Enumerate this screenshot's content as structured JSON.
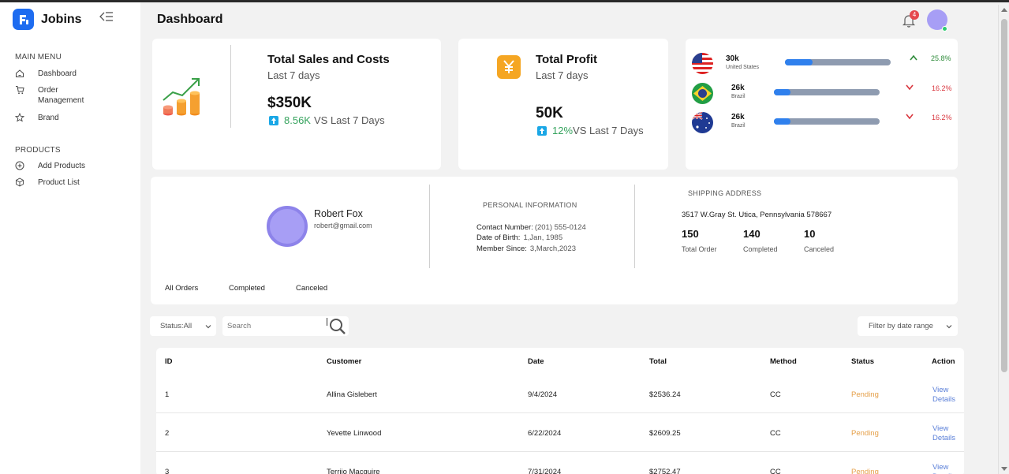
{
  "app": {
    "name": "Jobins"
  },
  "sidebar": {
    "main_menu_label": "MAIN MENU",
    "main_items": [
      {
        "label": "Dashboard",
        "icon": "home-icon"
      },
      {
        "label": "Order Management",
        "icon": "cart-icon"
      },
      {
        "label": "Brand",
        "icon": "star-icon"
      }
    ],
    "products_label": "PRODUCTS",
    "product_items": [
      {
        "label": "Add Products",
        "icon": "plus-circle-icon"
      },
      {
        "label": "Product List",
        "icon": "box-icon"
      }
    ]
  },
  "header": {
    "title": "Dashboard",
    "notification_count": "4"
  },
  "sales_card": {
    "title": "Total Sales and Costs",
    "subtitle": "Last 7 days",
    "value": "$350K",
    "delta_value": "8.56K",
    "delta_text": "VS Last 7 Days"
  },
  "profit_card": {
    "title": "Total Profit",
    "subtitle": "Last 7 days",
    "value": "50K",
    "delta_value": "12%",
    "delta_text": "VS Last 7 Days"
  },
  "countries": [
    {
      "value": "30k",
      "name": "United States",
      "progress": 0.26,
      "trend": "up",
      "percent": "25.8%",
      "flag": "us-flag-icon"
    },
    {
      "value": "26k",
      "name": "Brazil",
      "progress": 0.16,
      "trend": "down",
      "percent": "16.2%",
      "flag": "brazil-flag-icon"
    },
    {
      "value": "26k",
      "name": "Brazil",
      "progress": 0.16,
      "trend": "down",
      "percent": "16.2%",
      "flag": "australia-flag-icon"
    }
  ],
  "colors": {
    "accent": "#2f80ed",
    "up": "#2e8b3a",
    "down": "#d9363e",
    "pending": "#e5a04a",
    "avatar": "#a79ef5"
  },
  "profile": {
    "name": "Robert Fox",
    "email": "robert@gmail.com",
    "personal_info_label": "PERSONAL INFORMATION",
    "contact_label": "Contact Number:",
    "contact_value": "(201) 555-0124",
    "dob_label": "Date of Birth:",
    "dob_value": "1,Jan, 1985",
    "member_label": "Member Since:",
    "member_value": "3,March,2023",
    "shipping_label": "SHIPPING ADDRESS",
    "address": "3517 W.Gray St. Utica, Pennsylvania 578667",
    "stats": [
      {
        "value": "150",
        "label": "Total Order"
      },
      {
        "value": "140",
        "label": "Completed"
      },
      {
        "value": "10",
        "label": "Canceled"
      }
    ],
    "tabs": [
      "All Orders",
      "Completed",
      "Canceled"
    ]
  },
  "filters": {
    "status_value": "Status:All",
    "search_placeholder": "Search",
    "date_range": "Filter by date range"
  },
  "table": {
    "columns": [
      "ID",
      "Customer",
      "Date",
      "Total",
      "Method",
      "Status",
      "Action"
    ],
    "rows": [
      {
        "id": "1",
        "customer": "Allina Gislebert",
        "date": "9/4/2024",
        "total": "$2536.24",
        "method": "CC",
        "status": "Pending",
        "action": "View Details"
      },
      {
        "id": "2",
        "customer": "Yevette Linwood",
        "date": "6/22/2024",
        "total": "$2609.25",
        "method": "CC",
        "status": "Pending",
        "action": "View Details"
      },
      {
        "id": "3",
        "customer": "Terrijo Macguire",
        "date": "7/31/2024",
        "total": "$2752.47",
        "method": "CC",
        "status": "Pending",
        "action": "View Details"
      }
    ]
  }
}
